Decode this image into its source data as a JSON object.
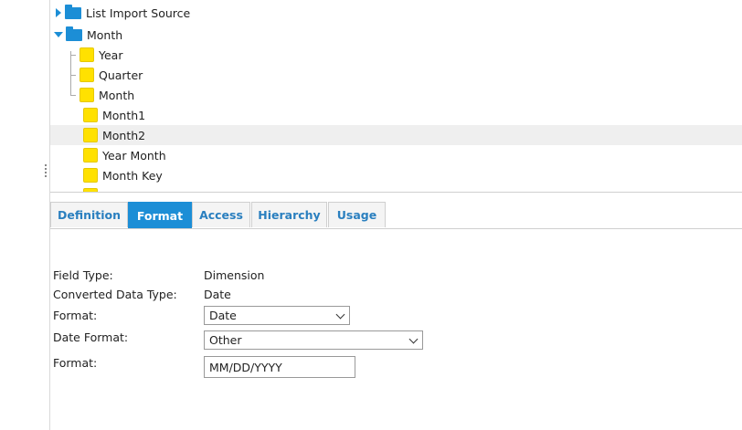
{
  "tree": {
    "items": [
      {
        "label": "List Import Source"
      },
      {
        "label": "Month"
      },
      {
        "label": "Year"
      },
      {
        "label": "Quarter"
      },
      {
        "label": "Month"
      },
      {
        "label": "Month1"
      },
      {
        "label": "Month2"
      },
      {
        "label": "Year Month"
      },
      {
        "label": "Month Key"
      }
    ]
  },
  "tabs": [
    {
      "label": "Definition"
    },
    {
      "label": "Format"
    },
    {
      "label": "Access"
    },
    {
      "label": "Hierarchy"
    },
    {
      "label": "Usage"
    }
  ],
  "form": {
    "field_type_label": "Field Type:",
    "field_type_value": "Dimension",
    "converted_label": "Converted Data Type:",
    "converted_value": "Date",
    "format_label": "Format:",
    "format_selected": "Date",
    "date_format_label": "Date Format:",
    "date_format_selected": "Other",
    "format_text_label": "Format:",
    "format_text_value": "MM/DD/YYYY"
  },
  "colors": {
    "accent": "#1c8ed6",
    "field_icon": "#ffe100"
  }
}
